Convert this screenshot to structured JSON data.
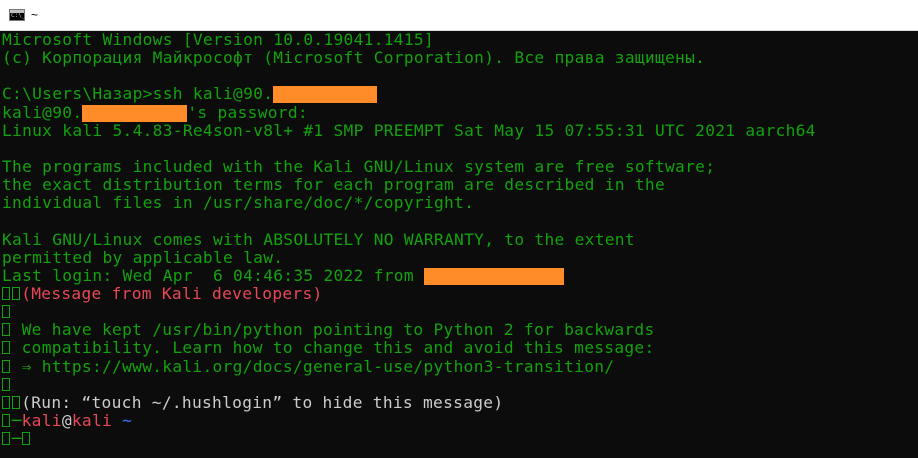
{
  "window": {
    "title": "~"
  },
  "terminal": {
    "lines": {
      "l1": "Microsoft Windows [Version 10.0.19041.1415]",
      "l2": "(с) Корпорация Майкрософт (Microsoft Corporation). Все права защищены.",
      "l4_prompt": "C:\\Users\\Назар>ssh kali@90.",
      "l5_user": "kali@90.",
      "l5_suffix": "'s password:",
      "l6": "Linux kali 5.4.83-Re4son-v8l+ #1 SMP PREEMPT Sat May 15 07:55:31 UTC 2021 aarch64",
      "l8": "The programs included with the Kali GNU/Linux system are free software;",
      "l9": "the exact distribution terms for each program are described in the",
      "l10": "individual files in /usr/share/doc/*/copyright.",
      "l12": "Kali GNU/Linux comes with ABSOLUTELY NO WARRANTY, to the extent",
      "l13": "permitted by applicable law.",
      "l14": "Last login: Wed Apr  6 04:46:35 2022 from ",
      "l15": "(Message from Kali developers)",
      "l17": " We have kept /usr/bin/python pointing to Python 2 for backwards",
      "l18": " compatibility. Learn how to change this and avoid this message:",
      "l19": " ⇒ https://www.kali.org/docs/general-use/python3-transition/",
      "l21": "(Run: “touch ~/.hushlogin” to hide this message)",
      "l22_dash": "─",
      "l22_user": "kali",
      "l22_at": "@",
      "l22_host": "kali",
      "l22_dir": " ~",
      "l23_dash": "─"
    }
  },
  "colors": {
    "terminal_bg": "#0c0c0c",
    "text_green": "#13a10e",
    "text_gray": "#cccccc",
    "text_red": "#e74856",
    "text_blue": "#3b78ff",
    "redaction": "#ff8c28"
  },
  "icons": {
    "app": "cmd-icon",
    "glyph": "missing-glyph-box"
  }
}
